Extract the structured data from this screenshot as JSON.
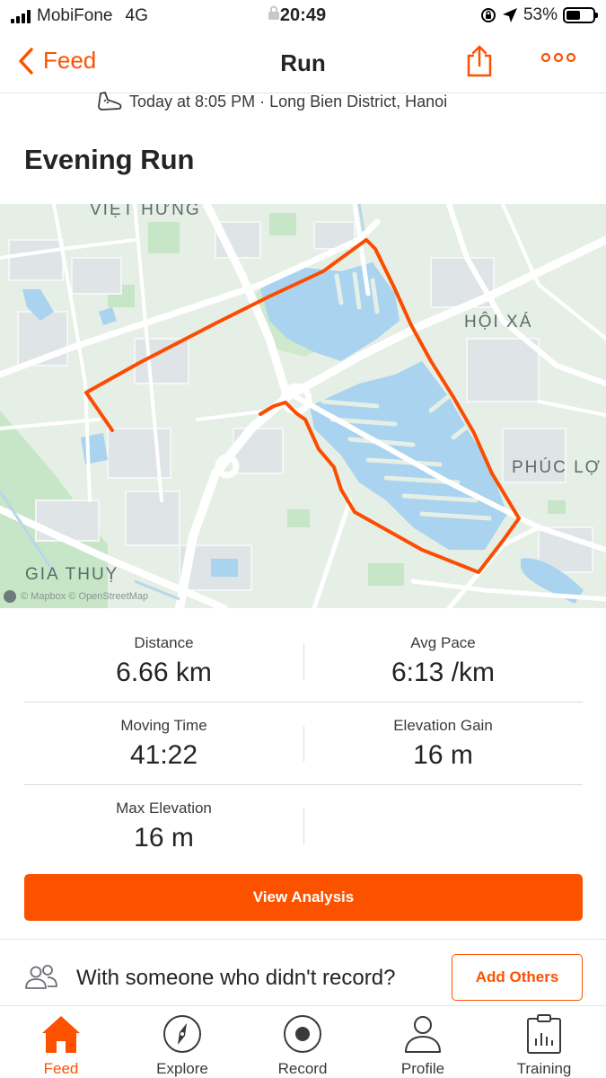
{
  "status_bar": {
    "carrier": "MobiFone",
    "network": "4G",
    "time": "20:49",
    "battery": "53%",
    "battery_level": 0.53
  },
  "nav": {
    "back_label": "Feed",
    "title": "Run"
  },
  "activity": {
    "meta": "Today at 8:05 PM · Long Bien District, Hanoi",
    "title": "Evening Run"
  },
  "map": {
    "labels": {
      "viet_hung": "VIỆT HƯNG",
      "hoi_xa": "HỘI XÁ",
      "phuc_loi": "PHÚC LỢ",
      "gia_thuy": "GIA THUỴ"
    },
    "attribution": "© Mapbox © OpenStreetMap",
    "route_color": "#fc4c02"
  },
  "stats": [
    {
      "label": "Distance",
      "value": "6.66 km"
    },
    {
      "label": "Avg Pace",
      "value": "6:13 /km"
    },
    {
      "label": "Moving Time",
      "value": "41:22"
    },
    {
      "label": "Elevation Gain",
      "value": "16 m"
    },
    {
      "label": "Max Elevation",
      "value": "16 m"
    }
  ],
  "view_analysis_label": "View Analysis",
  "with_others": {
    "text": "With someone who didn't record?",
    "button": "Add Others"
  },
  "tabbar": {
    "items": [
      {
        "label": "Feed",
        "icon": "home-icon"
      },
      {
        "label": "Explore",
        "icon": "compass-icon"
      },
      {
        "label": "Record",
        "icon": "record-icon"
      },
      {
        "label": "Profile",
        "icon": "profile-icon"
      },
      {
        "label": "Training",
        "icon": "calendar-chart-icon"
      }
    ]
  },
  "colors": {
    "accent": "#fc5200",
    "text": "#242428",
    "water": "#a9d3ee",
    "park": "#c6e6c7"
  }
}
